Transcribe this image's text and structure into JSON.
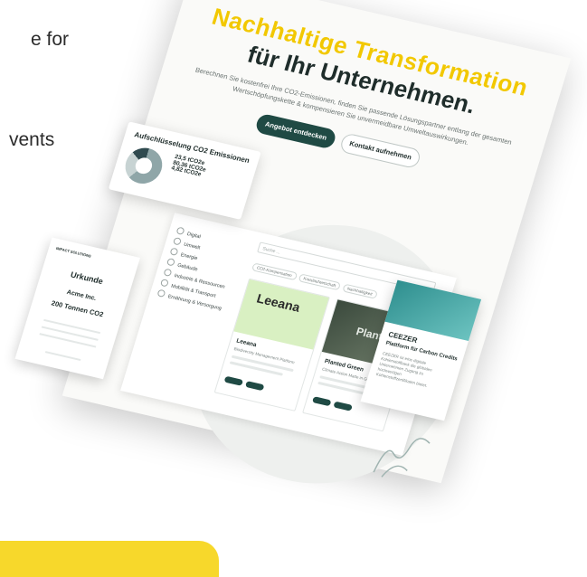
{
  "side_text": {
    "line1": "e for",
    "line2": "vents"
  },
  "hero": {
    "title_line1": "Nachhaltige Transformation",
    "title_line2": "für Ihr Unternehmen.",
    "subtitle": "Berechnen Sie kostenfrei Ihre CO2-Emissionen, finden Sie passende Lösungspartner entlang der gesamten Wertschöpfungskette & kompensieren Sie unvermeidbare Umweltauswirkungen.",
    "primary_button": "Angebot entdecken",
    "secondary_button": "Kontakt aufnehmen"
  },
  "co2_card": {
    "title": "Aufschlüsselung CO2 Emissionen",
    "values": [
      "23,5 tCO2e",
      "80,36 tCO2e",
      "4,82 tCO2e"
    ],
    "chart_colors": [
      "#8fa6a8",
      "#c7d3d3",
      "#2f4a4f"
    ]
  },
  "filters": [
    "Digital",
    "Umwelt",
    "Energie",
    "Gebäude",
    "Industrie & Ressourcen",
    "Mobilität & Transport",
    "Ernährung & Versorgung"
  ],
  "search": {
    "placeholder": "Suche ..."
  },
  "chips": [
    "CO2-Kompensation",
    "Kreislaufwirtschaft",
    "Nachhaltigkeit"
  ],
  "cards": [
    {
      "logo": "Leeana",
      "name": "Leeana",
      "desc": "Biodiversity Management Platform"
    },
    {
      "logo": "Planted",
      "name": "Planted Green",
      "desc": "Climate Action Made in Germany"
    }
  ],
  "ceezer": {
    "name": "CEEZER",
    "subtitle": "Plattform für Carbon Credits",
    "desc": "CEEZER ist eine digitale Kohlenstoffbank die globalen Unternehmen Zugang zu hochwertigen Kohlenstoffzertifikaten bietet."
  },
  "urkunde": {
    "badge": "IMPACT SOLUTIONS",
    "title": "Urkunde",
    "company": "Acme Inc.",
    "amount": "200 Tonnen CO2"
  },
  "colors": {
    "accent_yellow": "#f7d82b",
    "brand_dark": "#1f4a44"
  }
}
